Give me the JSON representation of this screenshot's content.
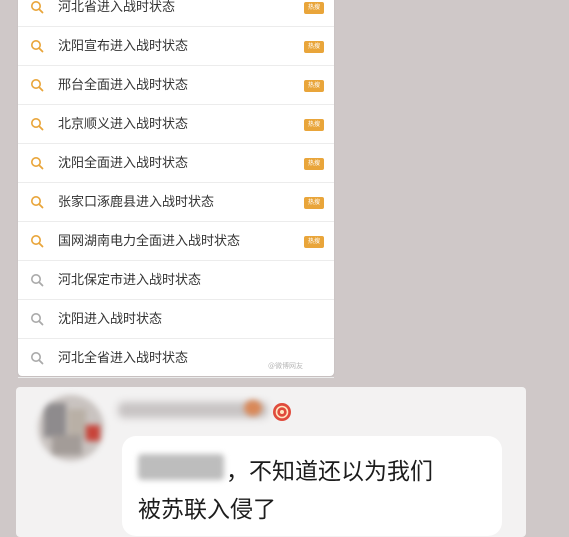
{
  "search_suggestions": [
    {
      "text": "河北省进入战时状态",
      "hot": true
    },
    {
      "text": "沈阳宣布进入战时状态",
      "hot": true
    },
    {
      "text": "邢台全面进入战时状态",
      "hot": true
    },
    {
      "text": "北京顺义进入战时状态",
      "hot": true
    },
    {
      "text": "沈阳全面进入战时状态",
      "hot": true
    },
    {
      "text": "张家口涿鹿县进入战时状态",
      "hot": true
    },
    {
      "text": "国网湖南电力全面进入战时状态",
      "hot": true
    },
    {
      "text": "河北保定市进入战时状态",
      "hot": false
    },
    {
      "text": "沈阳进入战时状态",
      "hot": false
    },
    {
      "text": "河北全省进入战时状态",
      "hot": false
    }
  ],
  "hot_badge_label": "热搜",
  "watermark": "@微博网友",
  "chat": {
    "message_line1": "，不知道还以为我们",
    "message_line2": "被苏联入侵了"
  },
  "icons": {
    "hot_search_icon": "magnifier-orange",
    "plain_search_icon": "magnifier-gray",
    "level_badge_icon": "red-level-badge"
  },
  "colors": {
    "hot_icon": "#e9a53a",
    "plain_icon": "#aaaaaa",
    "badge_red": "#e04b3c"
  }
}
